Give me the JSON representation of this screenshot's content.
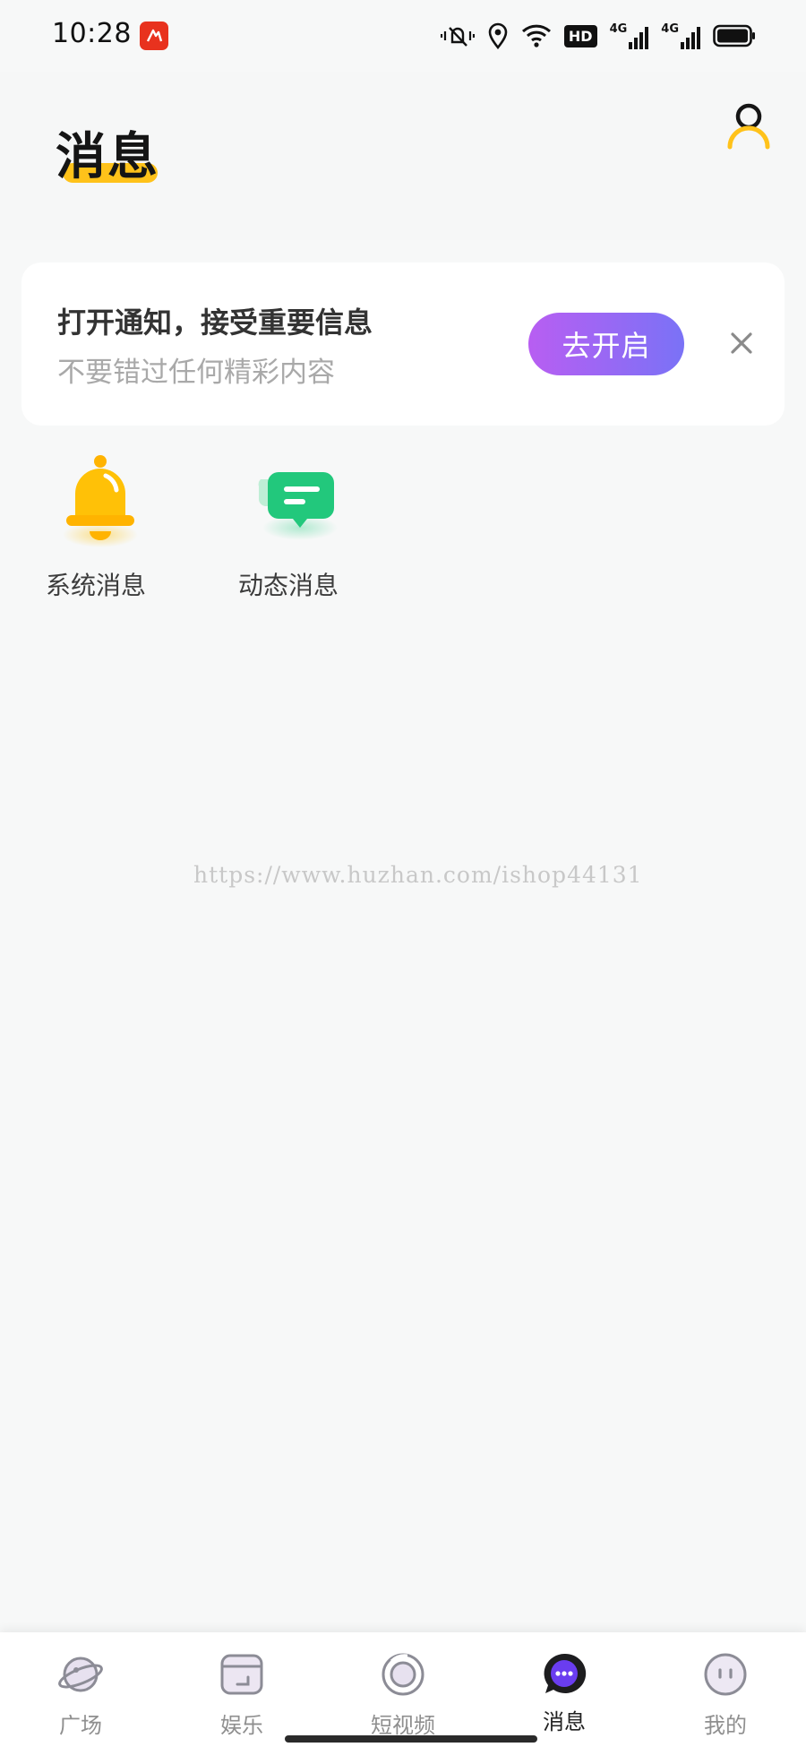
{
  "status_bar": {
    "time": "10:28",
    "icons": [
      "app-notification-icon",
      "vibrate-mute-icon",
      "location-icon",
      "wifi-icon",
      "hd-icon",
      "signal-4g-icon",
      "signal-4g-icon",
      "battery-icon"
    ],
    "hd_label": "HD",
    "network_label_1": "4G",
    "network_label_2": "4G"
  },
  "header": {
    "title": "消息",
    "accent_color": "#ffc21a",
    "profile_icon": "user-profile-icon"
  },
  "notification_banner": {
    "title": "打开通知，接受重要信息",
    "subtitle": "不要错过任何精彩内容",
    "enable_button_label": "去开启",
    "close_icon": "close-icon",
    "button_gradient": [
      "#b85ef2",
      "#7a72f6"
    ]
  },
  "categories": [
    {
      "label": "系统消息",
      "icon": "bell-icon",
      "color": "#ffc107"
    },
    {
      "label": "动态消息",
      "icon": "chat-bubble-icon",
      "color": "#2ecf86"
    }
  ],
  "watermark": "https://www.huzhan.com/ishop44131",
  "tab_bar": {
    "active_index": 3,
    "tabs": [
      {
        "label": "广场",
        "icon": "planet-icon"
      },
      {
        "label": "娱乐",
        "icon": "entertainment-icon"
      },
      {
        "label": "短视频",
        "icon": "video-icon"
      },
      {
        "label": "消息",
        "icon": "message-icon"
      },
      {
        "label": "我的",
        "icon": "profile-face-icon"
      }
    ],
    "active_color": "#5a3ae0"
  }
}
